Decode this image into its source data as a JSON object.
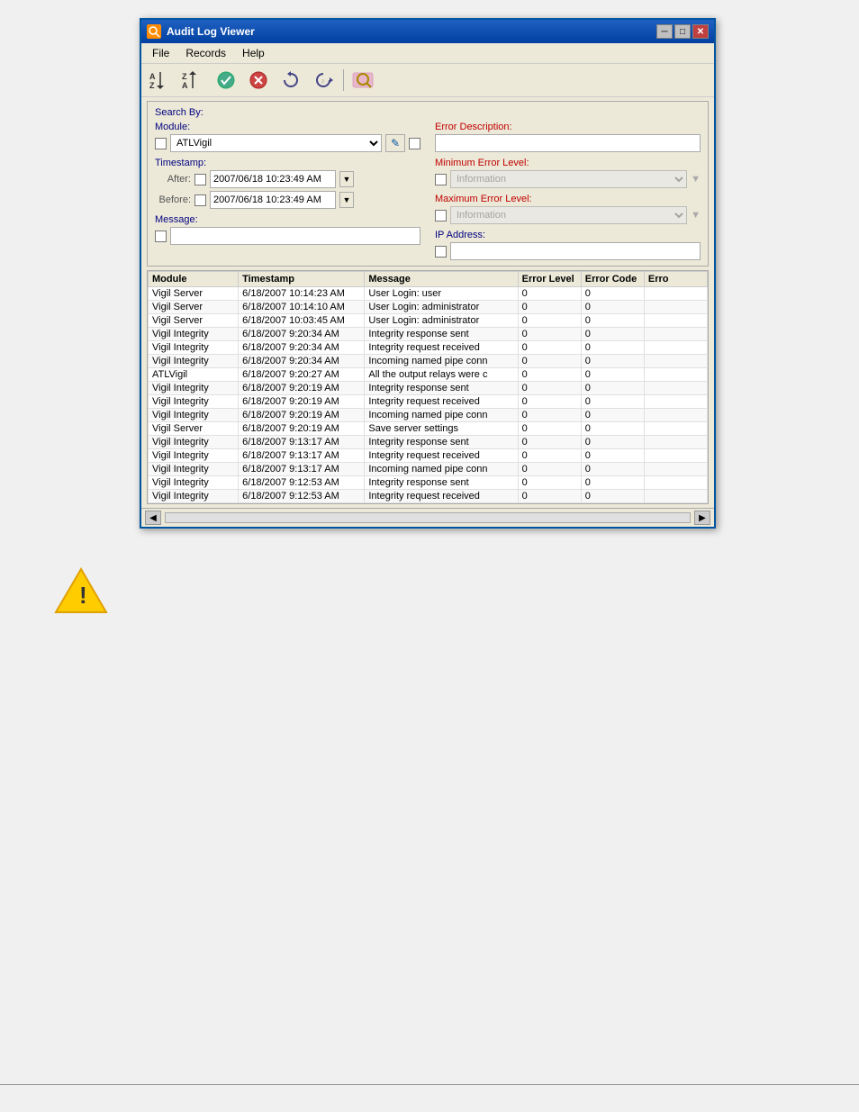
{
  "window": {
    "title": "Audit Log Viewer",
    "title_icon": "🔍"
  },
  "menu": {
    "items": [
      "File",
      "Records",
      "Help"
    ]
  },
  "toolbar": {
    "buttons": [
      {
        "name": "sort-az",
        "icon": "↓A→Z",
        "label": "Sort A-Z"
      },
      {
        "name": "sort-za",
        "icon": "↑Z→A",
        "label": "Sort Z-A"
      },
      {
        "name": "filter",
        "icon": "✔",
        "label": "Filter"
      },
      {
        "name": "filter-remove",
        "icon": "✗",
        "label": "Remove Filter"
      },
      {
        "name": "refresh",
        "icon": "↺",
        "label": "Refresh"
      },
      {
        "name": "refresh2",
        "icon": "↻",
        "label": "Refresh2"
      },
      {
        "name": "search",
        "icon": "🔍",
        "label": "Search"
      }
    ]
  },
  "search": {
    "section_title": "Search By:",
    "module_label": "Module:",
    "module_value": "ATLVigil",
    "error_desc_label": "Error Description:",
    "error_desc_value": "",
    "timestamp_label": "Timestamp:",
    "after_label": "After:",
    "after_value": "2007/06/18 10:23:49 AM",
    "before_label": "Before:",
    "before_value": "2007/06/18 10:23:49 AM",
    "min_error_label": "Minimum Error Level:",
    "min_error_value": "Information",
    "max_error_label": "Maximum Error Level:",
    "max_error_value": "Information",
    "message_label": "Message:",
    "message_value": "",
    "ip_label": "IP Address:",
    "ip_value": ""
  },
  "table": {
    "columns": [
      "Module",
      "Timestamp",
      "Message",
      "Error Level",
      "Error Code",
      "Erro"
    ],
    "rows": [
      {
        "module": "Vigil Server",
        "timestamp": "6/18/2007 10:14:23 AM",
        "message": "User Login: user",
        "error_level": "0",
        "error_code": "0",
        "error_desc": ""
      },
      {
        "module": "Vigil Server",
        "timestamp": "6/18/2007 10:14:10 AM",
        "message": "User Login: administrator",
        "error_level": "0",
        "error_code": "0",
        "error_desc": ""
      },
      {
        "module": "Vigil Server",
        "timestamp": "6/18/2007 10:03:45 AM",
        "message": "User Login: administrator",
        "error_level": "0",
        "error_code": "0",
        "error_desc": ""
      },
      {
        "module": "Vigil Integrity",
        "timestamp": "6/18/2007 9:20:34 AM",
        "message": "Integrity response sent",
        "error_level": "0",
        "error_code": "0",
        "error_desc": ""
      },
      {
        "module": "Vigil Integrity",
        "timestamp": "6/18/2007 9:20:34 AM",
        "message": "Integrity request received",
        "error_level": "0",
        "error_code": "0",
        "error_desc": ""
      },
      {
        "module": "Vigil Integrity",
        "timestamp": "6/18/2007 9:20:34 AM",
        "message": "Incoming named pipe conn",
        "error_level": "0",
        "error_code": "0",
        "error_desc": ""
      },
      {
        "module": "ATLVigil",
        "timestamp": "6/18/2007 9:20:27 AM",
        "message": "All the output relays were c",
        "error_level": "0",
        "error_code": "0",
        "error_desc": ""
      },
      {
        "module": "Vigil Integrity",
        "timestamp": "6/18/2007 9:20:19 AM",
        "message": "Integrity response sent",
        "error_level": "0",
        "error_code": "0",
        "error_desc": ""
      },
      {
        "module": "Vigil Integrity",
        "timestamp": "6/18/2007 9:20:19 AM",
        "message": "Integrity request received",
        "error_level": "0",
        "error_code": "0",
        "error_desc": ""
      },
      {
        "module": "Vigil Integrity",
        "timestamp": "6/18/2007 9:20:19 AM",
        "message": "Incoming named pipe conn",
        "error_level": "0",
        "error_code": "0",
        "error_desc": ""
      },
      {
        "module": "Vigil Server",
        "timestamp": "6/18/2007 9:20:19 AM",
        "message": "Save server settings",
        "error_level": "0",
        "error_code": "0",
        "error_desc": ""
      },
      {
        "module": "Vigil Integrity",
        "timestamp": "6/18/2007 9:13:17 AM",
        "message": "Integrity response sent",
        "error_level": "0",
        "error_code": "0",
        "error_desc": ""
      },
      {
        "module": "Vigil Integrity",
        "timestamp": "6/18/2007 9:13:17 AM",
        "message": "Integrity request received",
        "error_level": "0",
        "error_code": "0",
        "error_desc": ""
      },
      {
        "module": "Vigil Integrity",
        "timestamp": "6/18/2007 9:13:17 AM",
        "message": "Incoming named pipe conn",
        "error_level": "0",
        "error_code": "0",
        "error_desc": ""
      },
      {
        "module": "Vigil Integrity",
        "timestamp": "6/18/2007 9:12:53 AM",
        "message": "Integrity response sent",
        "error_level": "0",
        "error_code": "0",
        "error_desc": ""
      },
      {
        "module": "Vigil Integrity",
        "timestamp": "6/18/2007 9:12:53 AM",
        "message": "Integrity request received",
        "error_level": "0",
        "error_code": "0",
        "error_desc": ""
      }
    ]
  },
  "icons": {
    "sort_az": "AZ↓",
    "sort_za": "ZA↑",
    "minimize": "─",
    "maximize": "□",
    "close": "✕"
  }
}
